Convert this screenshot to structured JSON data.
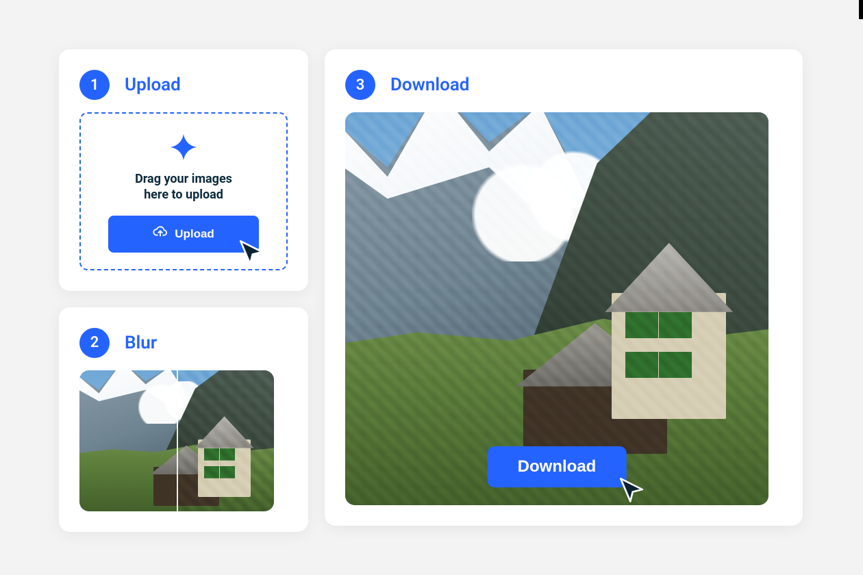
{
  "colors": {
    "primary": "#2563ff",
    "text_dark": "#0b2a3d"
  },
  "steps": {
    "upload": {
      "num": "1",
      "title": "Upload"
    },
    "blur": {
      "num": "2",
      "title": "Blur"
    },
    "download": {
      "num": "3",
      "title": "Download"
    }
  },
  "dropzone": {
    "hint": "Drag your images\nhere to upload",
    "button_label": "Upload"
  },
  "download": {
    "button_label": "Download"
  }
}
